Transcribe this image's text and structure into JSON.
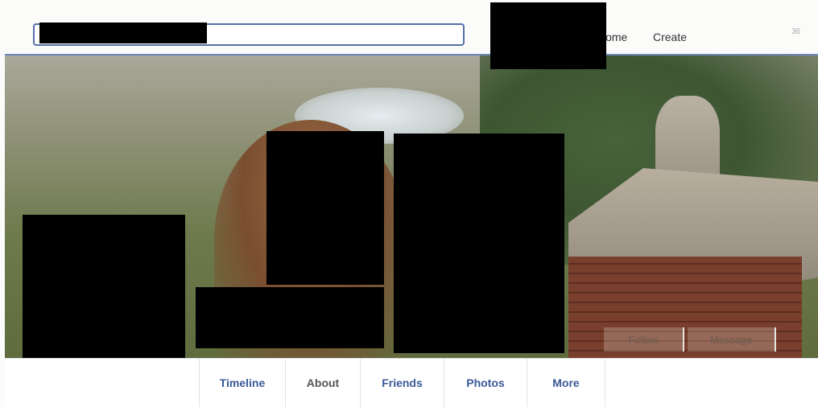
{
  "header": {
    "search": {
      "value": "",
      "placeholder": ""
    },
    "nav": {
      "home": "Home",
      "create": "Create"
    },
    "notifications_count": "36"
  },
  "cover": {
    "buttons": {
      "follow": "Follow",
      "message": "Message"
    }
  },
  "tabs": [
    "Timeline",
    "About",
    "Friends",
    "Photos",
    "More"
  ],
  "colors": {
    "link_blue": "#3b5998",
    "search_border": "#5570a8",
    "redaction": "#000000"
  }
}
